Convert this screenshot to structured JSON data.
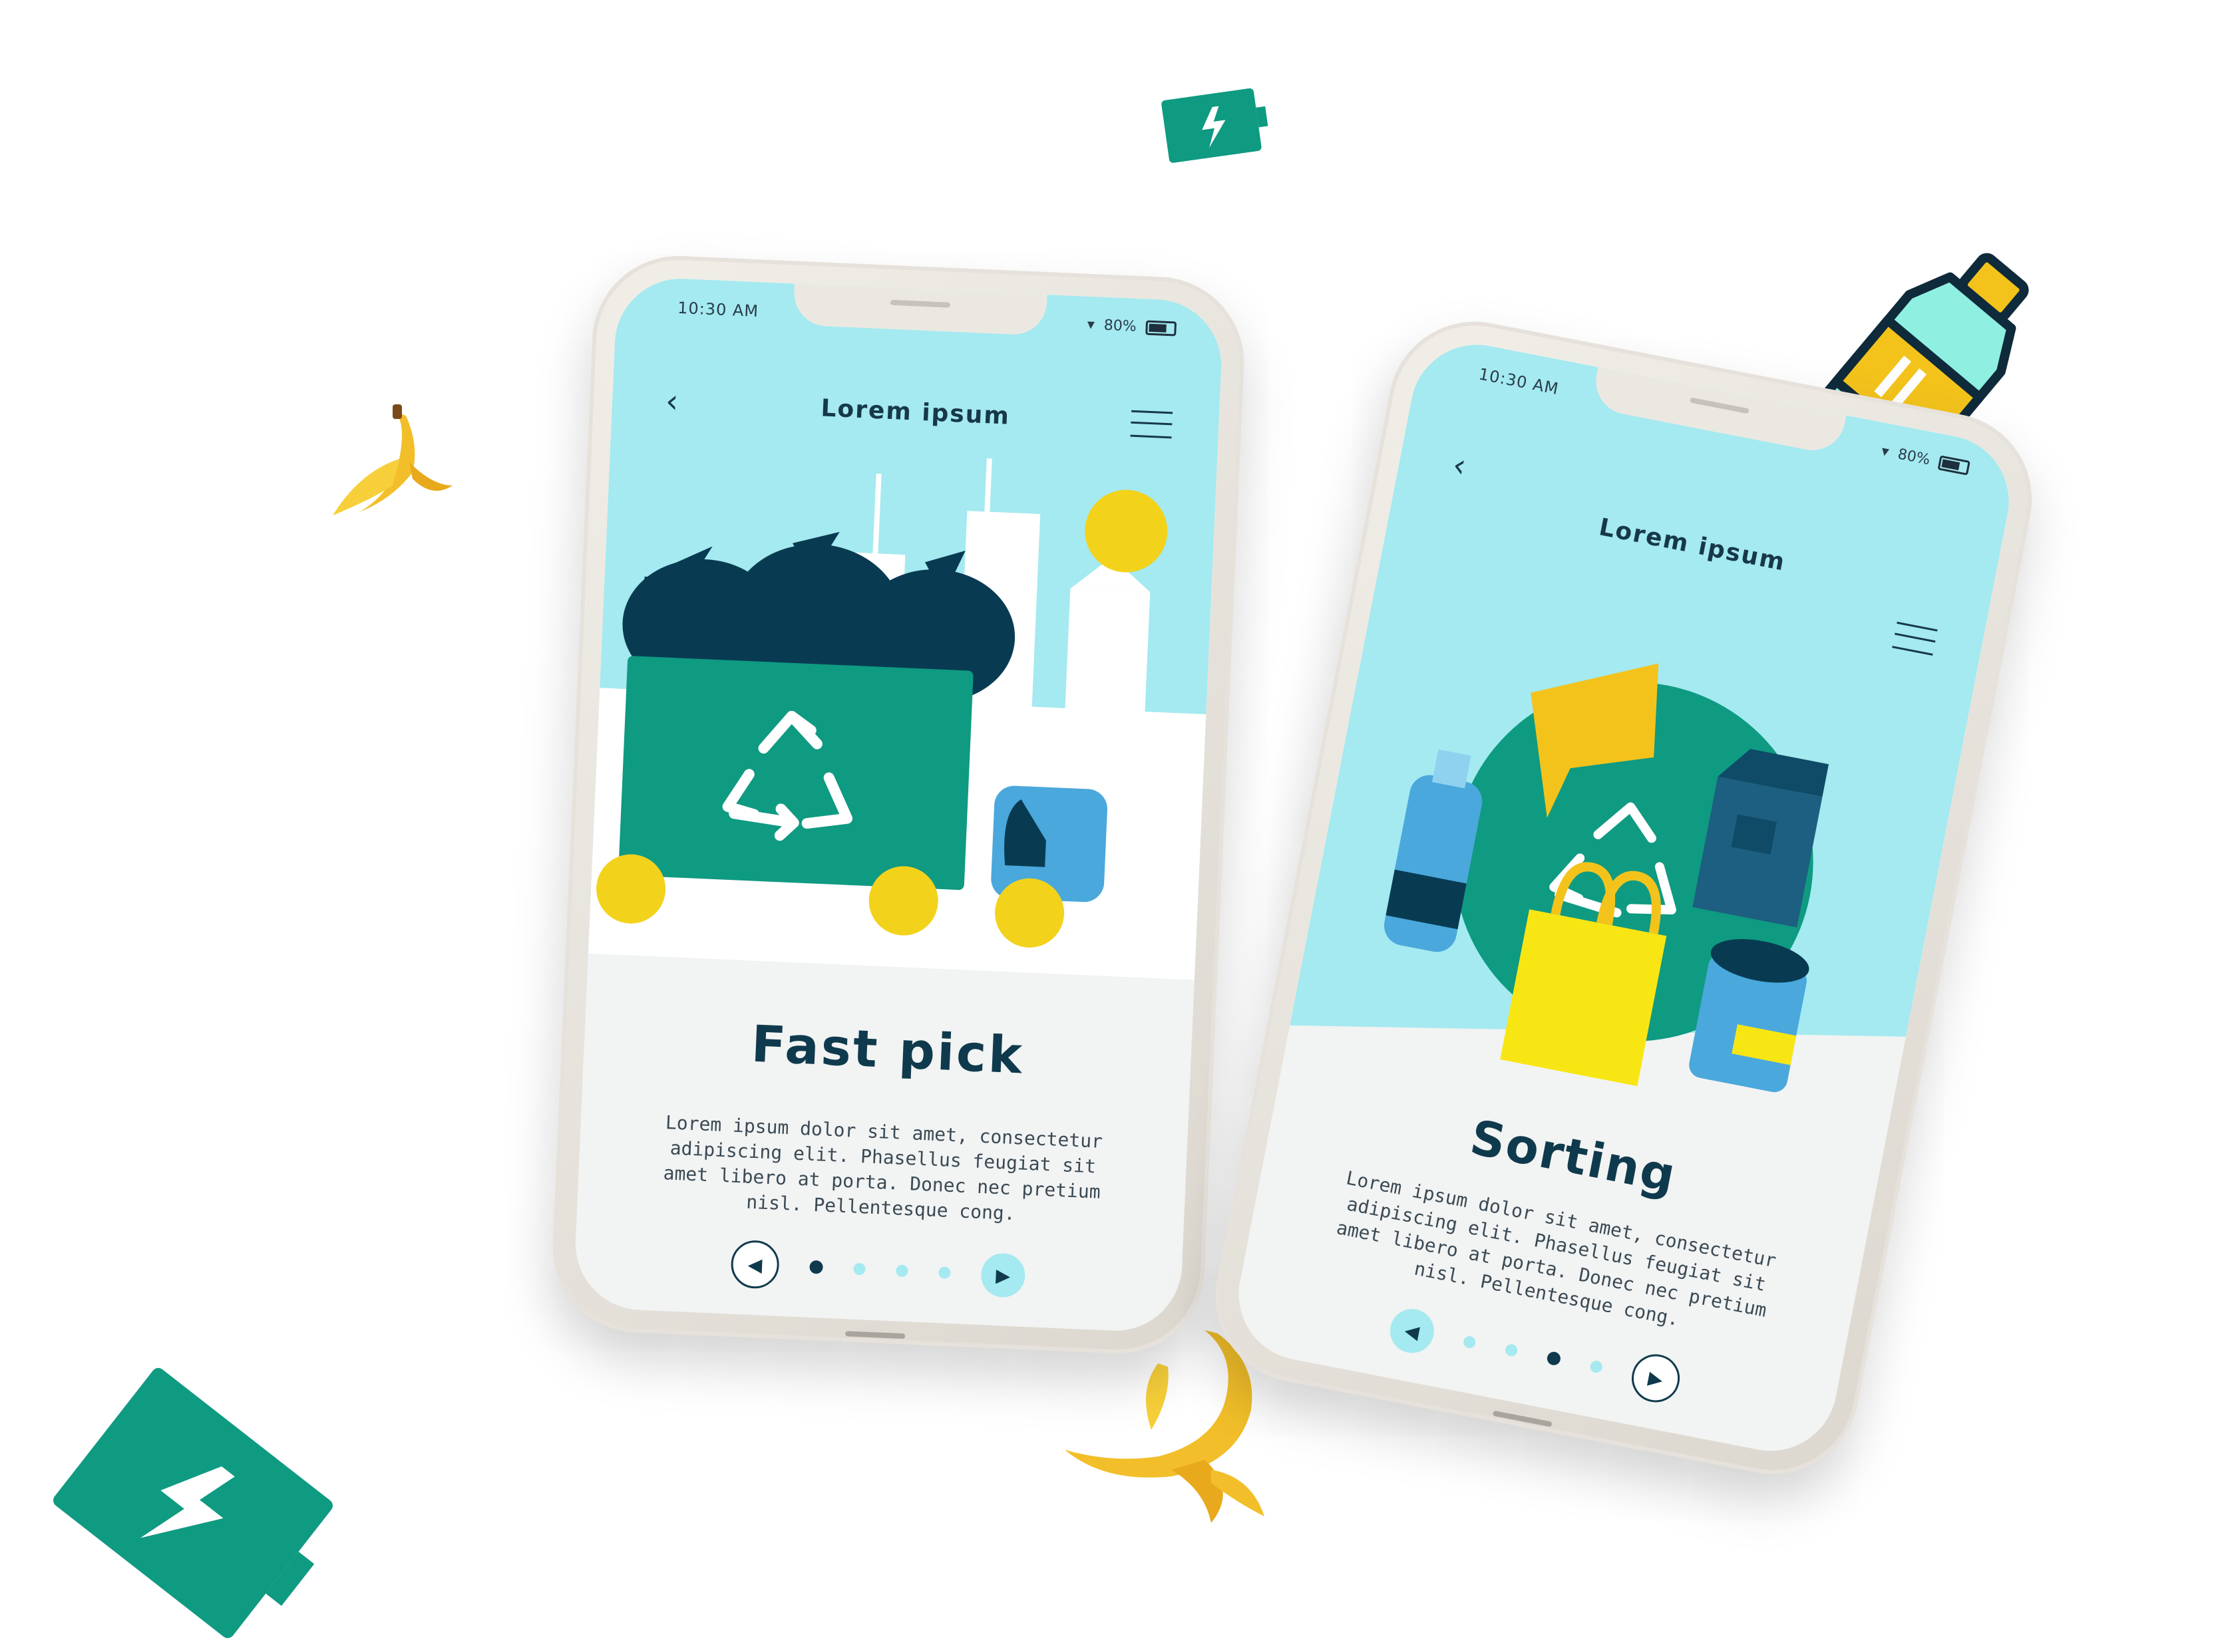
{
  "colors": {
    "teal": "#0f9a82",
    "navy": "#0f3a4d",
    "sky": "#a4eaf0",
    "yellow": "#f3d21c",
    "blue": "#4aa8dc",
    "banana": "#f2bf2a"
  },
  "left_phone": {
    "status_time": "10:30 AM",
    "status_battery": "80%",
    "header_title": "Lorem ipsum",
    "slide_title": "Fast pick",
    "slide_body": "Lorem ipsum dolor sit amet, consectetur adipiscing elit. Phasellus feugiat sit amet libero at porta. Donec nec pretium nisl. Pellentesque cong.",
    "pager": {
      "dots": 4,
      "active_index": 0
    },
    "icons": [
      "back-arrow-icon",
      "menu-icon",
      "recycle-icon",
      "prev-icon",
      "next-icon"
    ]
  },
  "right_phone": {
    "status_time": "10:30 AM",
    "status_battery": "80%",
    "header_title": "Lorem ipsum",
    "slide_title": "Sorting",
    "slide_body": "Lorem ipsum dolor sit amet, consectetur adipiscing elit. Phasellus feugiat sit amet libero at porta. Donec nec pretium nisl. Pellentesque cong.",
    "pager": {
      "dots": 4,
      "active_index": 2
    },
    "icons": [
      "back-arrow-icon",
      "menu-icon",
      "recycle-icon",
      "prev-icon",
      "next-icon"
    ]
  },
  "decor": {
    "items": [
      "banana-peel-icon",
      "bottle-icon",
      "battery-icon"
    ]
  }
}
